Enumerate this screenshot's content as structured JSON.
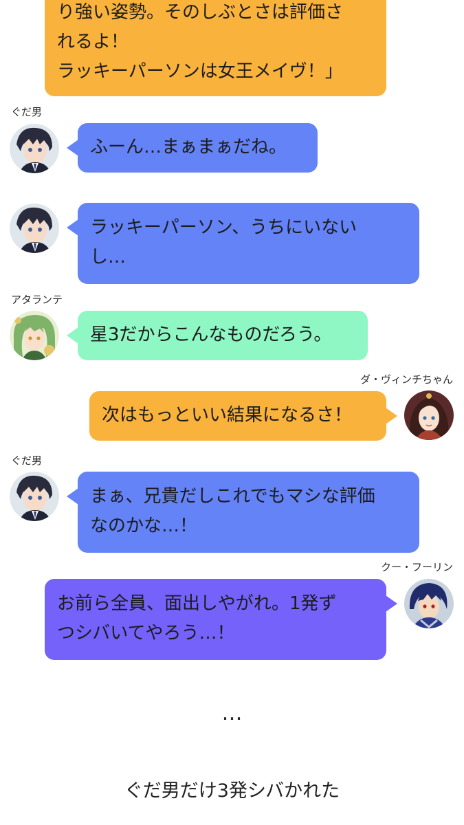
{
  "messages": [
    {
      "text": "り強い姿勢。そのしぶとさは評価さ\nれるよ！\nラッキーパーソンは女王メイヴ！」",
      "color": "#f9b23b"
    },
    {
      "speaker": "ぐだ男",
      "text": "ふーん…まぁまぁだね。",
      "color": "#6383f7"
    },
    {
      "text": "ラッキーパーソン、うちにいない\nし…",
      "color": "#6383f7"
    },
    {
      "speaker": "アタランテ",
      "text": "星3だからこんなものだろう。",
      "color": "#8ef7c4"
    },
    {
      "speaker": "ダ・ヴィンチちゃん",
      "text": "次はもっといい結果になるさ！",
      "color": "#f9b23b"
    },
    {
      "speaker": "ぐだ男",
      "text": "まぁ、兄貴だしこれでもマシな評価\nなのかな…！",
      "color": "#6383f7"
    },
    {
      "speaker": "クー・フーリン",
      "text": "お前ら全員、面出しやがれ。1発ず\nつシバいてやろう…！",
      "color": "#7462fb"
    }
  ],
  "ellipsis": "…",
  "caption": "ぐだ男だけ3発シバかれた",
  "avatars": {
    "gudao": "gudao-avatar",
    "atalante": "atalante-avatar",
    "davinci": "davinci-avatar",
    "cu": "cu-chulainn-avatar"
  }
}
